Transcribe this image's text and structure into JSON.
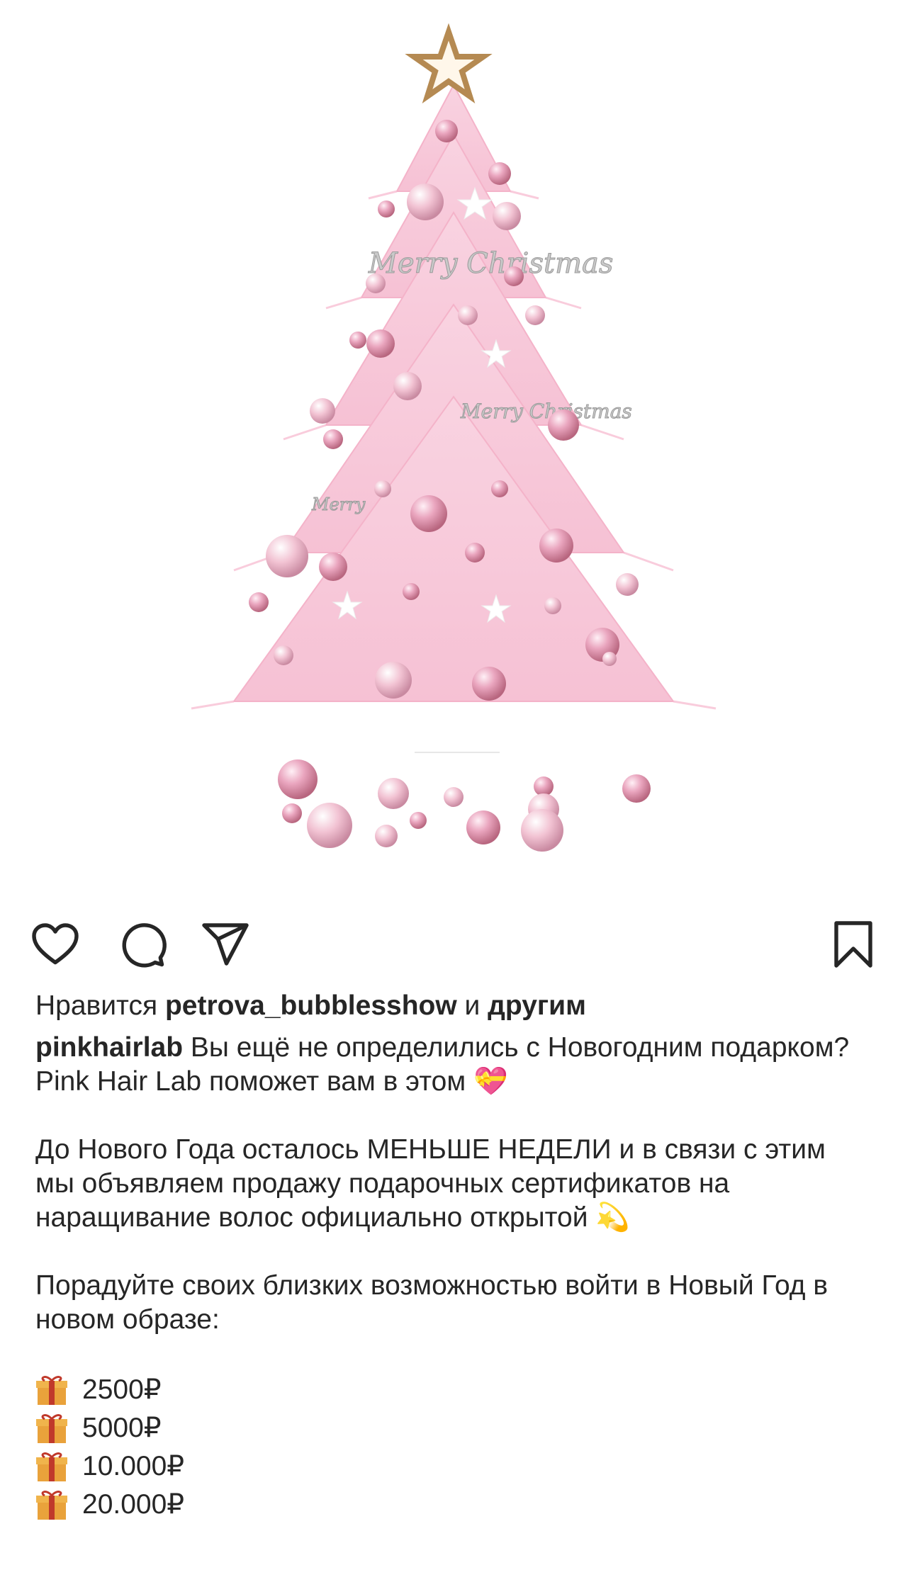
{
  "post": {
    "image_alt": "pink christmas tree",
    "image_text": "Merry Christmas"
  },
  "actions": {
    "like_icon": "heart-icon",
    "comment_icon": "comment-icon",
    "share_icon": "paper-plane-icon",
    "save_icon": "bookmark-icon"
  },
  "likes": {
    "prefix": "Нравится ",
    "user": "petrova_bubblesshow",
    "middle": " и ",
    "others": "другим"
  },
  "caption": {
    "username": "pinkhairlab",
    "line1": " Вы ещё не определились с Новогодним подарком? Pink Hair Lab поможет вам в этом",
    "line1_emoji": "💝",
    "para2": "До Нового Года осталось МЕНЬШЕ НЕДЕЛИ и в связи с этим мы объявляем продажу подарочных сертификатов на наращивание волос официально открытой",
    "para2_emoji": "💫",
    "para3": "Порадуйте своих близких возможностью войти в Новый Год в новом образе:",
    "gifts": [
      "2500₽",
      "5000₽",
      "10.000₽",
      "20.000₽"
    ]
  },
  "colors": {
    "tree": "#f8c6d8",
    "ornament": "#e7a3b8",
    "star": "#b58a52"
  }
}
